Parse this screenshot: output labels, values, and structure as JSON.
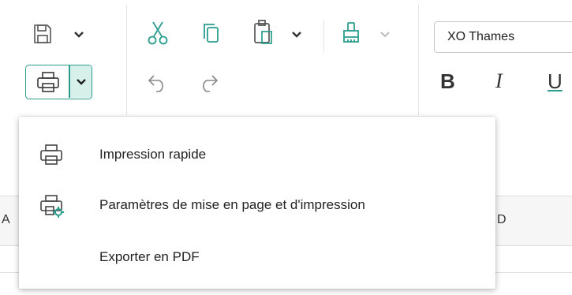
{
  "toolbar": {
    "font_name": "XO Thames",
    "format_buttons": [
      "B",
      "I",
      "U"
    ],
    "accent_color": "#2a9d8f",
    "print_button_bg": "#d7f0ea"
  },
  "sheet": {
    "column_letters": [
      "A",
      "D"
    ]
  },
  "print_menu": {
    "items": [
      {
        "label": "Impression rapide",
        "icon": "printer-icon"
      },
      {
        "label": "Paramètres de mise en page et d'impression",
        "icon": "printer-settings-icon"
      },
      {
        "label": "Exporter en PDF",
        "icon": ""
      }
    ]
  }
}
